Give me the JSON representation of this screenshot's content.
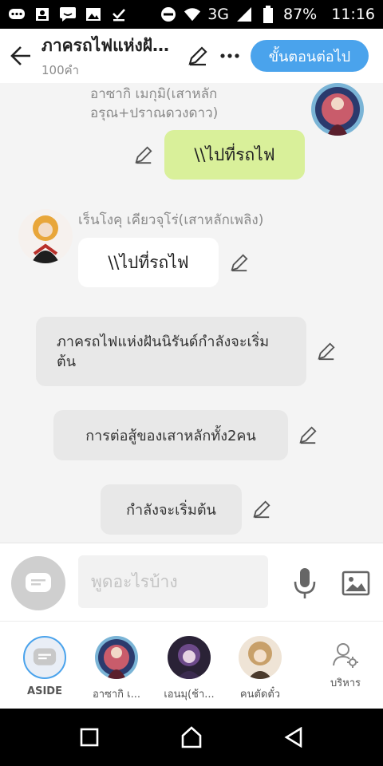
{
  "status_bar": {
    "network": "3G",
    "battery": "87%",
    "time": "11:16"
  },
  "header": {
    "title": "ภาครถไฟแห่งฝันนิรันดร์",
    "word_count": "100คำ",
    "next_label": "ขั้นตอนต่อไป"
  },
  "messages": {
    "msg1": {
      "speaker": "อาซากิ เมกุมิ(เสาหลักอรุณ+ปราณดวงดาว)",
      "text": "\\\\ไปที่รถไฟ"
    },
    "msg2": {
      "speaker": "เร็นโงคุ เคียวจุโร่(เสาหลักเพลิง)",
      "text": "\\\\ไปที่รถไฟ"
    },
    "narr1": "ภาครถไฟแห่งฝันนิรันด์กำลังจะเริ่มต้น",
    "narr2": "การต่อสู้ของเสาหลักทั้ง2คน",
    "narr3": "กำลังจะเริ่มต้น"
  },
  "input": {
    "placeholder": "พูดอะไรบ้าง"
  },
  "characters": [
    {
      "label": "ASIDE"
    },
    {
      "label": "อาซากิ เ..."
    },
    {
      "label": "เอนมุ(ช้า..."
    },
    {
      "label": "คนตัดตั๋ว"
    },
    {
      "label": "บริหาร"
    }
  ],
  "colors": {
    "accent": "#4aa3ec",
    "own_bubble": "#d9f09a",
    "narration_bg": "#e8e8e8"
  }
}
